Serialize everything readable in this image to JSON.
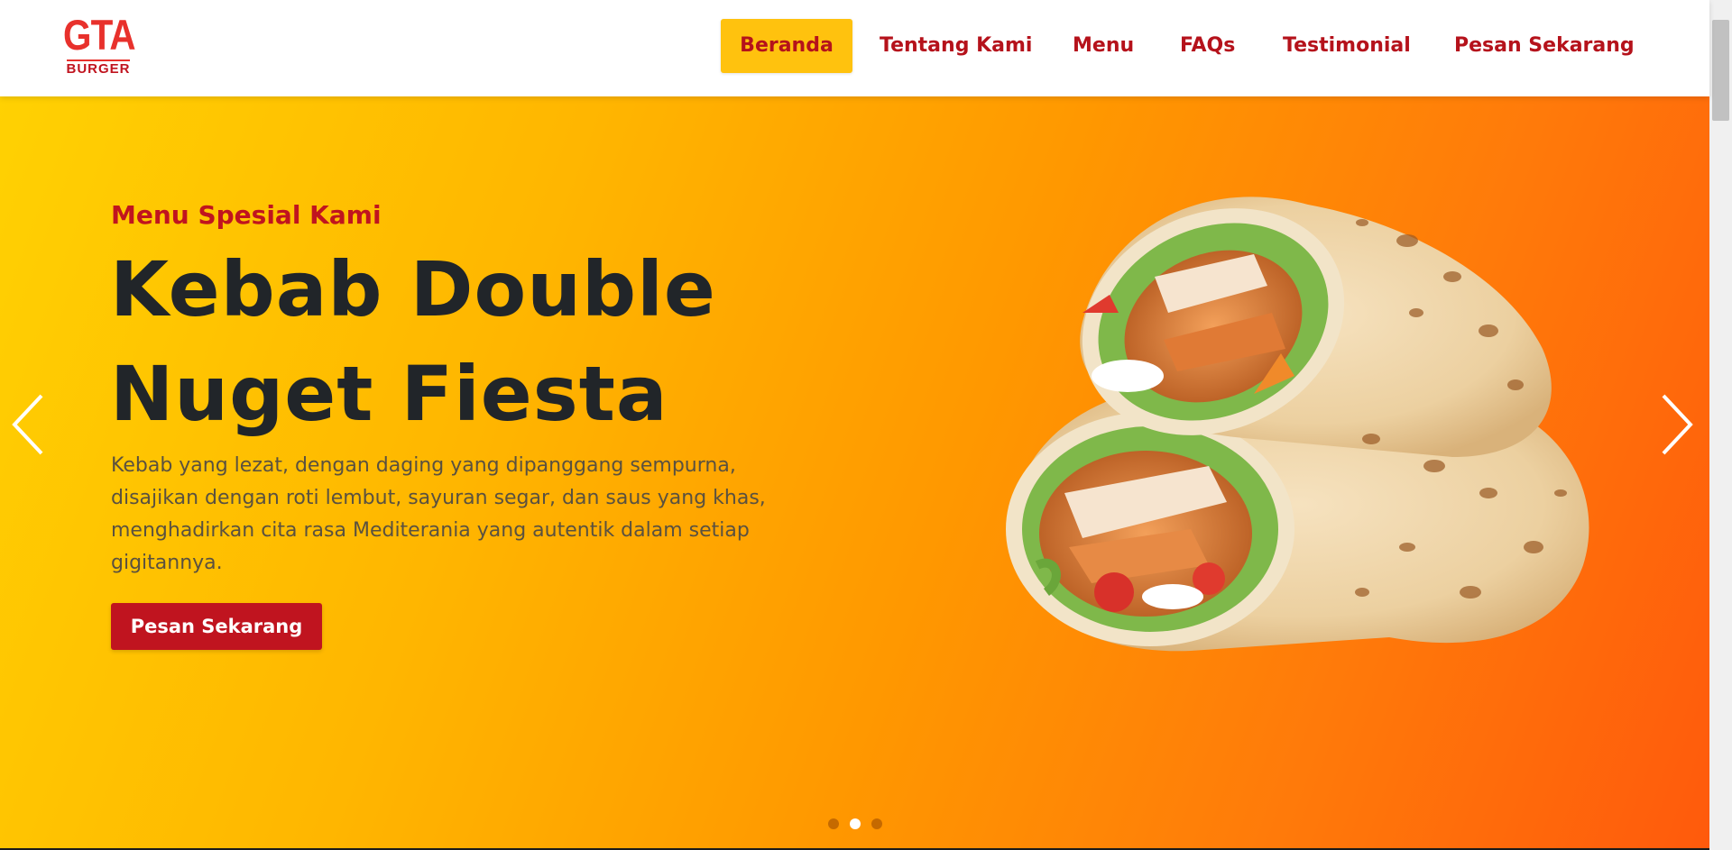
{
  "logo": {
    "top": "GTA",
    "bottom": "BURGER"
  },
  "nav": {
    "items": [
      {
        "label": "Beranda",
        "active": true
      },
      {
        "label": "Tentang Kami",
        "active": false
      },
      {
        "label": "Menu",
        "active": false
      },
      {
        "label": "FAQs",
        "active": false
      },
      {
        "label": "Testimonial",
        "active": false
      },
      {
        "label": "Pesan Sekarang",
        "active": false
      }
    ]
  },
  "hero": {
    "subtitle": "Menu Spesial Kami",
    "title_line1": "Kebab Double",
    "title_line2": "Nuget Fiesta",
    "description": "Kebab yang lezat, dengan daging yang dipanggang sempurna, disajikan dengan roti lembut, sayuran segar, dan saus yang khas, menghadirkan cita rasa Mediterania yang autentik dalam setiap gigitannya.",
    "button_label": "Pesan Sekarang"
  },
  "carousel": {
    "slide_count": 3,
    "active_slide": 2
  },
  "colors": {
    "brand_red": "#c0141f",
    "accent_yellow": "#ffc20e",
    "gradient_start": "#ffd102",
    "gradient_end": "#ff5a0c"
  },
  "icons": {
    "prev": "chevron-left-icon",
    "next": "chevron-right-icon"
  }
}
